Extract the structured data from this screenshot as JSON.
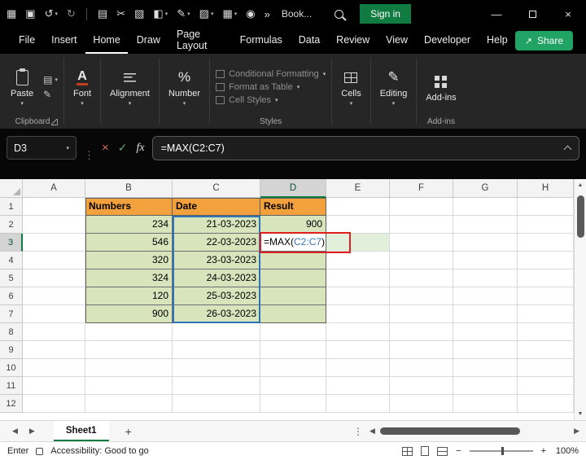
{
  "titlebar": {
    "title": "Book...",
    "sign_in_label": "Sign in",
    "icons": [
      {
        "name": "quick-access-icon",
        "glyph": "▦"
      },
      {
        "name": "save-icon",
        "glyph": "▣"
      },
      {
        "name": "undo-icon",
        "glyph": "↺",
        "chevron": true
      },
      {
        "name": "redo-icon",
        "glyph": "↻",
        "dim": true
      },
      {
        "name": "separator",
        "sep": true
      },
      {
        "name": "clipboard-icon",
        "glyph": "▤"
      },
      {
        "name": "cut-icon",
        "glyph": "✂"
      },
      {
        "name": "picture-icon",
        "glyph": "▧"
      },
      {
        "name": "fill-color-icon",
        "glyph": "◧",
        "chevron": true
      },
      {
        "name": "pen-icon",
        "glyph": "✎",
        "chevron": true
      },
      {
        "name": "highlighter-icon",
        "glyph": "▨",
        "chevron": true
      },
      {
        "name": "table-icon",
        "glyph": "▦",
        "chevron": true
      },
      {
        "name": "camera-icon",
        "glyph": "◉"
      },
      {
        "name": "overflow-icon",
        "glyph": "»"
      }
    ],
    "minimize_glyph": "—",
    "close_glyph": "×"
  },
  "menubar": {
    "tabs": [
      "File",
      "Insert",
      "Home",
      "Draw",
      "Page Layout",
      "Formulas",
      "Data",
      "Review",
      "View",
      "Developer",
      "Help"
    ],
    "active": "Home",
    "share_label": "Share",
    "share_icon_glyph": "↗"
  },
  "ribbon": {
    "paste_label": "Paste",
    "groups": {
      "clipboard": "Clipboard",
      "styles": "Styles",
      "addins": "Add-ins"
    },
    "buttons": {
      "font": "Font",
      "alignment": "Alignment",
      "number": "Number",
      "number_glyph": "%",
      "cells": "Cells",
      "editing": "Editing",
      "editing_glyph": "✎",
      "addins": "Add-ins"
    },
    "styles_items": [
      "Conditional Formatting",
      "Format as Table",
      "Cell Styles"
    ]
  },
  "formula_bar": {
    "name_box": "D3",
    "cancel_glyph": "×",
    "enter_glyph": "✓",
    "fx_label": "fx",
    "full": "=MAX(C2:C7)",
    "prefix": "=MAX(",
    "range": "C2:C7",
    "suffix": ")"
  },
  "grid": {
    "columns": [
      "A",
      "B",
      "C",
      "D",
      "E",
      "F",
      "G",
      "H"
    ],
    "active_column": "D",
    "active_row": 3,
    "rows": [
      {
        "n": 1,
        "cells": {
          "B": {
            "t": "Numbers",
            "s": "th"
          },
          "C": {
            "t": "Date",
            "s": "th"
          },
          "D": {
            "t": "Result",
            "s": "th"
          }
        }
      },
      {
        "n": 2,
        "cells": {
          "B": {
            "t": "234",
            "s": "num"
          },
          "C": {
            "t": "21-03-2023",
            "s": "num"
          },
          "D": {
            "t": "900",
            "s": "num"
          }
        }
      },
      {
        "n": 3,
        "cells": {
          "B": {
            "t": "546",
            "s": "num"
          },
          "C": {
            "t": "22-03-2023",
            "s": "num"
          },
          "D": {
            "s": "formula"
          },
          "E": {
            "s": "elight"
          }
        }
      },
      {
        "n": 4,
        "cells": {
          "B": {
            "t": "320",
            "s": "num"
          },
          "C": {
            "t": "23-03-2023",
            "s": "num"
          },
          "D": {
            "s": "emptyg"
          }
        }
      },
      {
        "n": 5,
        "cells": {
          "B": {
            "t": "324",
            "s": "num"
          },
          "C": {
            "t": "24-03-2023",
            "s": "num"
          },
          "D": {
            "s": "emptyg"
          }
        }
      },
      {
        "n": 6,
        "cells": {
          "B": {
            "t": "120",
            "s": "num"
          },
          "C": {
            "t": "25-03-2023",
            "s": "num"
          },
          "D": {
            "s": "emptyg"
          }
        }
      },
      {
        "n": 7,
        "cells": {
          "B": {
            "t": "900",
            "s": "num"
          },
          "C": {
            "t": "26-03-2023",
            "s": "num"
          },
          "D": {
            "s": "emptyg"
          }
        }
      },
      {
        "n": 8
      },
      {
        "n": 9
      },
      {
        "n": 10
      },
      {
        "n": 11
      },
      {
        "n": 12
      }
    ]
  },
  "sheet_bar": {
    "nav_left": "◀",
    "nav_right": "▶",
    "tab": "Sheet1",
    "add": "+",
    "more": "⋮",
    "hs_left": "◀",
    "hs_right": "▶"
  },
  "status_bar": {
    "mode": "Enter",
    "accessibility": "Accessibility: Good to go",
    "zoom_out": "−",
    "zoom_in": "+",
    "zoom": "100%"
  },
  "scrollbar": {
    "up": "▲",
    "down": "▼"
  },
  "colors": {
    "accent_green": "#107C41",
    "share_green": "#21A366",
    "header_orange": "#F2A13C",
    "cell_green": "#D8E4BC",
    "ref_blue": "#2E75B6",
    "annotation_red": "#E01E1E"
  }
}
